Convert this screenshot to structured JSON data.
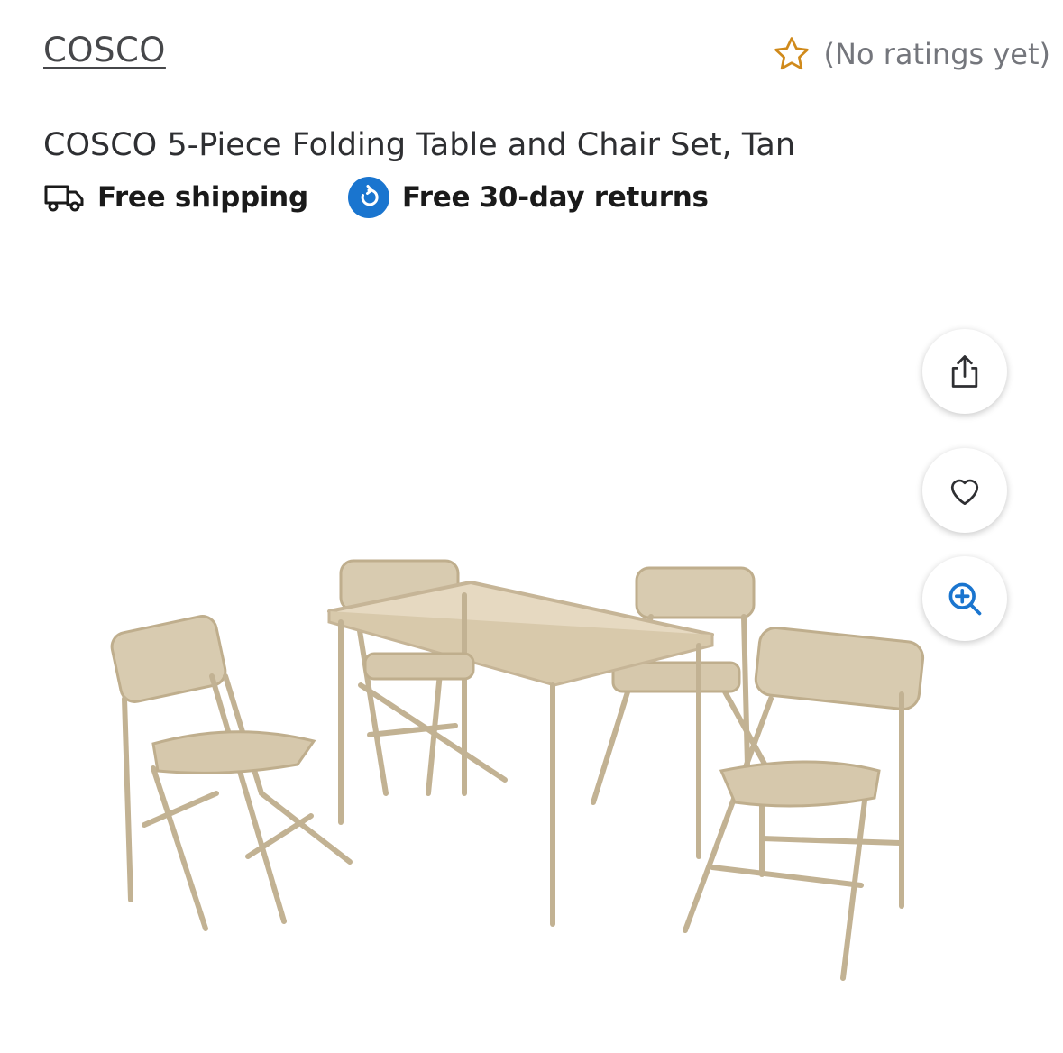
{
  "product": {
    "brand": "COSCO",
    "title": "COSCO 5-Piece Folding Table and Chair Set, Tan",
    "rating_text": "(No ratings yet)"
  },
  "badges": {
    "shipping": "Free shipping",
    "returns": "Free 30-day returns"
  },
  "icons": {
    "star": "star-outline-icon",
    "truck": "truck-icon",
    "returns": "returns-icon",
    "share": "share-icon",
    "favorite": "heart-icon",
    "zoom": "zoom-in-icon"
  },
  "colors": {
    "star": "#d08a1b",
    "returns_badge": "#1a75cf",
    "zoom": "#1a75cf",
    "furniture": "#cfc1a6"
  }
}
